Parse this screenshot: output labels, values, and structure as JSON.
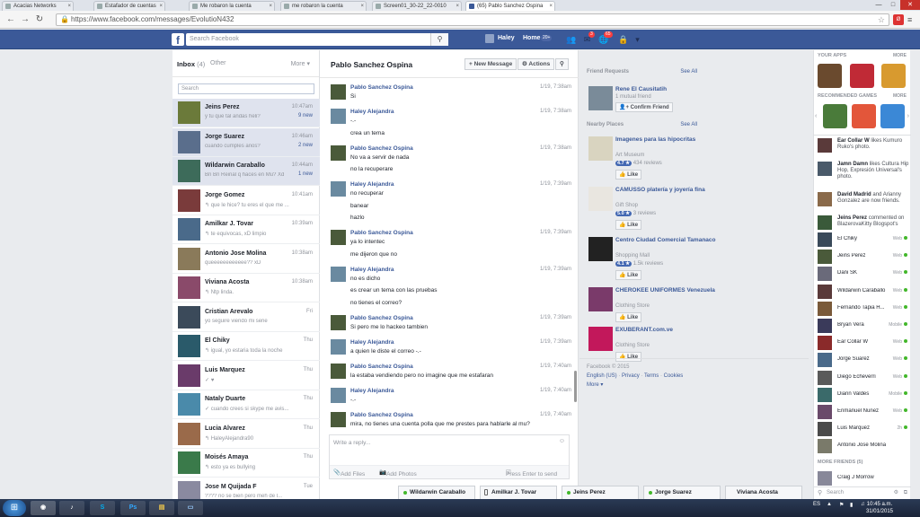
{
  "browser": {
    "tabs": [
      {
        "label": "Acacias Networks"
      },
      {
        "label": "Estafador de cuentas"
      },
      {
        "label": "Me robaron la cuenta"
      },
      {
        "label": "me robaron la cuenta"
      },
      {
        "label": "Screen01_30-22_22-0010"
      },
      {
        "label": "(65) Pablo Sanchez Ospina"
      }
    ],
    "url": "https://www.facebook.com/messages/EvolutioN432"
  },
  "fb_header": {
    "search_placeholder": "Search Facebook",
    "user": "Haley",
    "home": "Home",
    "home_count": "20+",
    "badge_messages": "3",
    "badge_notifications": "65"
  },
  "inbox": {
    "title": "Inbox",
    "count": "(4)",
    "other": "Other",
    "more": "More ▾",
    "search_placeholder": "Search",
    "threads": [
      {
        "name": "Jeins Perez",
        "snippet": "y tu que tal andas heli?",
        "time": "10:47am",
        "new": "9 new",
        "selected": true
      },
      {
        "name": "Jorge Suarez",
        "snippet": "cuando cumples años?",
        "time": "10:46am",
        "new": "2 new",
        "selected": true
      },
      {
        "name": "Wildarwin Caraballo",
        "snippet": "Bn Bn Reinal q haces en Mu? Xd",
        "time": "10:44am",
        "new": "1 new",
        "selected": true
      },
      {
        "name": "Jorge Gomez",
        "snippet": "↰ que le hice? tu eres el que me ...",
        "time": "10:41am",
        "new": "",
        "selected": false
      },
      {
        "name": "Amilkar J. Tovar",
        "snippet": "↰ te equivocas, xD limpio",
        "time": "10:39am",
        "new": "",
        "selected": false
      },
      {
        "name": "Antonio Jose Molina",
        "snippet": "queeeeeeeeeeee?? xD",
        "time": "10:38am",
        "new": "",
        "selected": false
      },
      {
        "name": "Viviana Acosta",
        "snippet": "↰ Ntp linda.",
        "time": "10:38am",
        "new": "",
        "selected": false
      },
      {
        "name": "Cristian Arevalo",
        "snippet": "yo seguire viendo mi serie",
        "time": "Fri",
        "new": "",
        "selected": false
      },
      {
        "name": "El Chiky",
        "snippet": "↰ igual, yo estaria toda la noche",
        "time": "Thu",
        "new": "",
        "selected": false
      },
      {
        "name": "Luis Marquez",
        "snippet": "✓ ♥",
        "time": "Thu",
        "new": "",
        "selected": false
      },
      {
        "name": "Nataly Duarte",
        "snippet": "✓ cuando crees si skype me avis...",
        "time": "Thu",
        "new": "",
        "selected": false
      },
      {
        "name": "Lucia Alvarez",
        "snippet": "↰ HaleyAlejandra90",
        "time": "Thu",
        "new": "",
        "selected": false
      },
      {
        "name": "Moisés Amaya",
        "snippet": "↰ esto ya es bullying",
        "time": "Thu",
        "new": "",
        "selected": false
      },
      {
        "name": "Jose M Quijada F",
        "snippet": "???? no se bien pero meh de l...",
        "time": "Tue",
        "new": "",
        "selected": false
      }
    ]
  },
  "conversation": {
    "title": "Pablo Sanchez Ospina",
    "new_message": "+ New Message",
    "actions": "⚙ Actions",
    "messages": [
      {
        "name": "Pablo Sanchez Ospina",
        "time": "1/19, 7:38am",
        "lines": [
          "Si"
        ]
      },
      {
        "name": "Haley Alejandra",
        "time": "1/19, 7:38am",
        "lines": [
          "-.-",
          "crea un tema"
        ]
      },
      {
        "name": "Pablo Sanchez Ospina",
        "time": "1/19, 7:38am",
        "lines": [
          "No va a servir de nada",
          "no la recuperare"
        ]
      },
      {
        "name": "Haley Alejandra",
        "time": "1/19, 7:39am",
        "lines": [
          "no recuperar",
          "banear",
          "hazlo"
        ]
      },
      {
        "name": "Pablo Sanchez Ospina",
        "time": "1/19, 7:39am",
        "lines": [
          "ya lo intentec",
          "me dijeron que no"
        ]
      },
      {
        "name": "Haley Alejandra",
        "time": "1/19, 7:39am",
        "lines": [
          "no es dicho",
          "es crear un tema con las pruebas",
          "no tienes el correo?"
        ]
      },
      {
        "name": "Pablo Sanchez Ospina",
        "time": "1/19, 7:39am",
        "lines": [
          "Si pero me lo hackeo tambien"
        ]
      },
      {
        "name": "Haley Alejandra",
        "time": "1/19, 7:39am",
        "lines": [
          "a quien le diste el correo -.-"
        ]
      },
      {
        "name": "Pablo Sanchez Ospina",
        "time": "1/19, 7:40am",
        "lines": [
          "la estaba vendiendo pero no imagine que me estafaran"
        ]
      },
      {
        "name": "Haley Alejandra",
        "time": "1/19, 7:40am",
        "lines": [
          "-.-"
        ]
      },
      {
        "name": "Pablo Sanchez Ospina",
        "time": "1/19, 7:40am",
        "lines": [
          "mira, no tienes una cuenta polla que me prestes para hablarle al mu?"
        ]
      }
    ],
    "composer_placeholder": "Write a reply...",
    "add_files": "Add Files",
    "add_photos": "Add Photos",
    "press_enter": "Press Enter to send"
  },
  "right": {
    "friend_requests": "Friend Requests",
    "see_all": "See All",
    "request": {
      "name": "Rene El Causitatih",
      "mutual": "1 mutual friend",
      "confirm": "Confirm Friend"
    },
    "nearby": "Nearby Places",
    "places": [
      {
        "name": "Imagenes para las hipocritas",
        "type": "Art Museum",
        "rating": "4.7 ★",
        "reviews": "434 reviews"
      },
      {
        "name": "CAMUSSO platería y joyería fina",
        "type": "Gift Shop",
        "rating": "5.0 ★",
        "reviews": "3 reviews"
      },
      {
        "name": "Centro Ciudad Comercial Tamanaco",
        "type": "Shopping Mall",
        "rating": "4.1 ★",
        "reviews": "1.5k reviews"
      },
      {
        "name": "CHEROKEE UNIFORMES Venezuela",
        "type": "Clothing Store",
        "rating": "",
        "reviews": ""
      },
      {
        "name": "EXUBERANT.com.ve",
        "type": "Clothing Store",
        "rating": "",
        "reviews": ""
      }
    ],
    "like": "Like",
    "footer": {
      "copyright": "Facebook © 2015",
      "lang": "English (US)",
      "privacy": "Privacy",
      "terms": "Terms",
      "cookies": "Cookies",
      "more": "More ▾"
    }
  },
  "sidebar": {
    "your_apps": "YOUR APPS",
    "more": "MORE",
    "recommended": "RECOMMENDED GAMES",
    "stories": [
      {
        "bold": "Ear Collar W",
        "text": " likes Kumuro Ruko's photo."
      },
      {
        "bold": "Jamn Damn",
        "text": " likes Cultura Hip Hop, Expresión Universal's photo."
      },
      {
        "bold": "David Madrid",
        "text": " and Arianny Gonzalez are now friends."
      },
      {
        "bold": "Jeins Perez",
        "text": " commented on BlazerovaKitty Blogspot's"
      }
    ],
    "contacts": [
      {
        "name": "El Chiky",
        "status": "Web"
      },
      {
        "name": "Jeins Perez",
        "status": "Web"
      },
      {
        "name": "Dani SK",
        "status": "Web"
      },
      {
        "name": "Wildarwin Caraballo",
        "status": "Web"
      },
      {
        "name": "Fernando Tapia H...",
        "status": "Web"
      },
      {
        "name": "Bryan Vera",
        "status": "Mobile"
      },
      {
        "name": "Ear Collar W",
        "status": "Web"
      },
      {
        "name": "Jorge Suarez",
        "status": "Web"
      },
      {
        "name": "Diego Echeverri",
        "status": "Web"
      },
      {
        "name": "Diann Valdes",
        "status": "Mobile"
      },
      {
        "name": "Enmanuel Nunez",
        "status": "Web"
      },
      {
        "name": "Luis Marquez",
        "status": "2h"
      },
      {
        "name": "Antonio Jose Molina",
        "status": ""
      }
    ],
    "more_friends": "MORE FRIENDS (5)",
    "craig": "Craig J Morrow",
    "search": "Search"
  },
  "chat_tabs": [
    {
      "name": "Wildarwin Caraballo",
      "kind": "web"
    },
    {
      "name": "Amilkar J. Tovar",
      "kind": "mobile"
    },
    {
      "name": "Jeins Perez",
      "kind": "web"
    },
    {
      "name": "Jorge Suarez",
      "kind": "web"
    },
    {
      "name": "Viviana Acosta",
      "kind": "none"
    }
  ],
  "taskbar": {
    "lang": "ES",
    "time": "10:45 a.m.",
    "date": "31/01/2015",
    "ps": "Ps"
  }
}
